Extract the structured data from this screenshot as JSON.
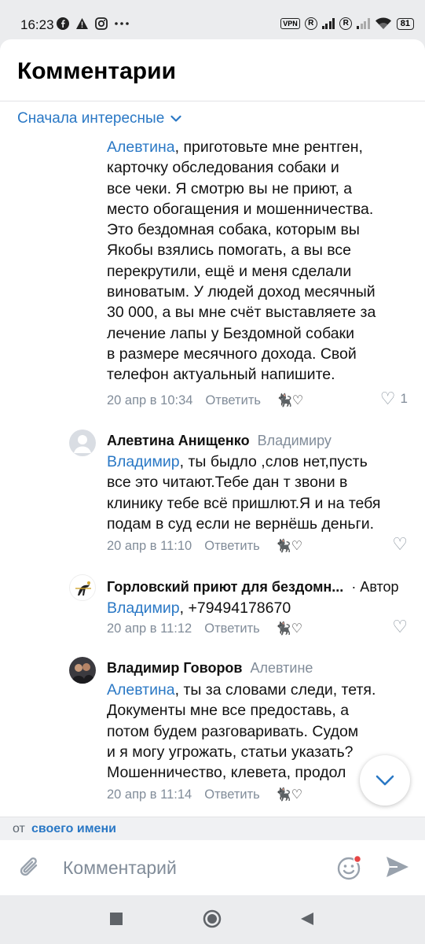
{
  "status_bar": {
    "time": "16:23",
    "left_icons": [
      "facebook-icon",
      "warning-icon",
      "instagram-icon",
      "more-dots-icon"
    ],
    "vpn": "VPN",
    "sim_badge": "R",
    "battery": "81"
  },
  "header": {
    "title": "Комментарии"
  },
  "sort": {
    "label": "Сначала интересные"
  },
  "comments": [
    {
      "mention": "Алевтина",
      "lines": [
        ", приготовьте мне рентген,",
        "карточку обследования собаки и",
        "все чеки. Я смотрю вы не приют, а",
        "место обогащения и мошенничества.",
        "Это бездомная собака, которым вы",
        "Якобы взялись помогать, а вы все",
        "перекрутили, ещё и меня сделали",
        "виноватым. У людей доход месячный",
        "30 000, а вы мне счёт выставляете за",
        "лечение лапы у Бездомной собаки",
        "в размере месячного дохода. Свой",
        "телефон актуальный напишите."
      ],
      "time": "20 апр в 10:34",
      "reply": "Ответить",
      "likes": "1"
    },
    {
      "author": "Алевтина Анищенко",
      "to": "Владимиру",
      "mention": "Владимир",
      "lines": [
        ", ты быдло ,слов нет,пусть",
        "все это читают.Тебе дан т звони в",
        "клинику тебе всё пришлют.Я и на тебя",
        "подам в суд если не вернёшь деньги."
      ],
      "time": "20 апр в 11:10",
      "reply": "Ответить"
    },
    {
      "author": "Горловский приют для бездомн...",
      "badge": "· Автор",
      "mention": "Владимир",
      "lines": [
        ", +79494178670"
      ],
      "time": "20 апр в 11:12",
      "reply": "Ответить"
    },
    {
      "author": "Владимир Говоров",
      "to": "Алевтине",
      "mention": "Алевтина",
      "lines": [
        ", ты за словами следи, тетя.",
        "Документы мне все предоставь, а",
        "потом будем разговаривать. Судом",
        "и я могу угрожать, статьи указать?",
        "Мошенничество, клевета, продол"
      ],
      "time": "20 апр в 11:14",
      "reply": "Ответить"
    }
  ],
  "from_bar": {
    "prefix": "от",
    "link": "своего имени"
  },
  "composer": {
    "placeholder": "Комментарий"
  },
  "colors": {
    "accent": "#2a78c5",
    "secondary_text": "#818c99"
  }
}
